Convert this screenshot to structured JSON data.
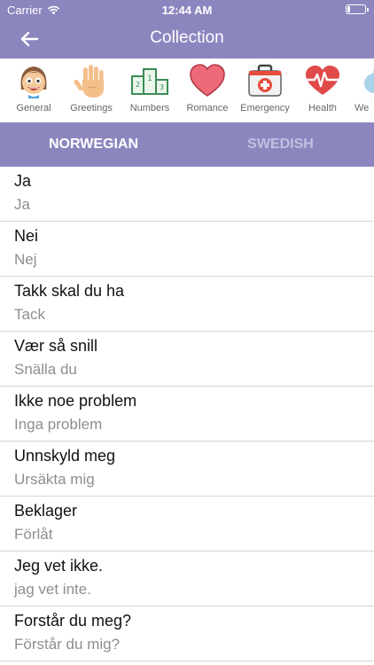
{
  "status": {
    "carrier": "Carrier",
    "time": "12:44 AM"
  },
  "navbar": {
    "title": "Collection"
  },
  "categories": [
    {
      "label": "General",
      "icon": "face-icon"
    },
    {
      "label": "Greetings",
      "icon": "hand-icon"
    },
    {
      "label": "Numbers",
      "icon": "podium-icon"
    },
    {
      "label": "Romance",
      "icon": "heart-icon"
    },
    {
      "label": "Emergency",
      "icon": "first-aid-icon"
    },
    {
      "label": "Health",
      "icon": "heartbeat-icon"
    },
    {
      "label": "We",
      "icon": "weather-icon"
    }
  ],
  "tabs": {
    "active": "NORWEGIAN",
    "inactive": "SWEDISH"
  },
  "colors": {
    "primary": "#8c86bf",
    "tab_inactive": "#c3bfe0",
    "secondary_text": "#8e8e8e"
  },
  "phrases": [
    {
      "norwegian": "Ja",
      "swedish": "Ja"
    },
    {
      "norwegian": "Nei",
      "swedish": "Nej"
    },
    {
      "norwegian": "Takk skal du ha",
      "swedish": "Tack"
    },
    {
      "norwegian": "Vær så snill",
      "swedish": "Snälla du"
    },
    {
      "norwegian": "Ikke noe problem",
      "swedish": "Inga problem"
    },
    {
      "norwegian": "Unnskyld meg",
      "swedish": "Ursäkta mig"
    },
    {
      "norwegian": "Beklager",
      "swedish": "Förlåt"
    },
    {
      "norwegian": "Jeg vet ikke.",
      "swedish": "jag vet inte."
    },
    {
      "norwegian": "Forstår du meg?",
      "swedish": "Förstår du mig?"
    }
  ]
}
